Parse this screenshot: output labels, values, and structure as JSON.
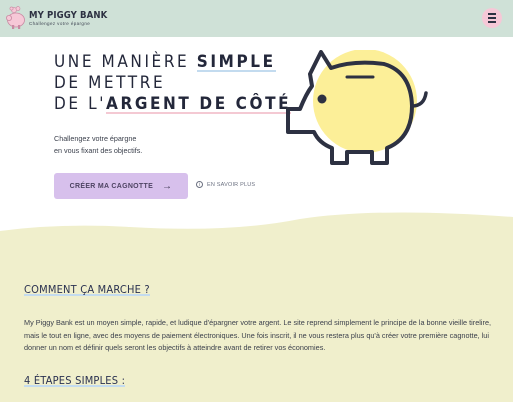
{
  "header": {
    "brand": "MY PIGGY BANK",
    "tagline": "Challengez votre épargne",
    "menu_icon": "hamburger-menu-icon"
  },
  "hero": {
    "title_line1_a": "UNE MANIÈRE ",
    "title_line1_b": "SIMPLE",
    "title_line2": "DE METTRE",
    "title_line3_a": "DE L'",
    "title_line3_b": "ARGENT DE CÔTÉ",
    "subtitle_line1": "Challengez votre épargne",
    "subtitle_line2": "en vous fixant des objectifs.",
    "cta_label": "CRÉER MA CAGNOTTE",
    "cta_icon": "arrow-right-icon",
    "learn_more_label": "EN SAVOIR PLUS",
    "learn_more_icon": "info-icon",
    "illustration": "piggy-bank-icon"
  },
  "how_it_works": {
    "title": "COMMENT ÇA MARCHE ?",
    "body": "My Piggy Bank est un moyen simple, rapide, et ludique d'épargner votre argent. Le site reprend simplement le principe de la bonne vieille tirelire, mais le tout en ligne, avec des moyens de paiement électroniques. Une fois inscrit, il ne vous restera plus qu'à créer votre première cagnotte, lui donner un nom et définir quels seront les objectifs à atteindre avant de retirer vos économies."
  },
  "steps": {
    "title": "4 ÉTAPES SIMPLES :"
  },
  "colors": {
    "header_bg": "#cfe1d7",
    "menu_button": "#f6c8d7",
    "cta_bg": "#d7c0ec",
    "section_bg": "#f0efcc",
    "pig_fill": "#fcef98",
    "highlight_blue": "#c3dbef",
    "highlight_pink": "#f4c9d3"
  }
}
